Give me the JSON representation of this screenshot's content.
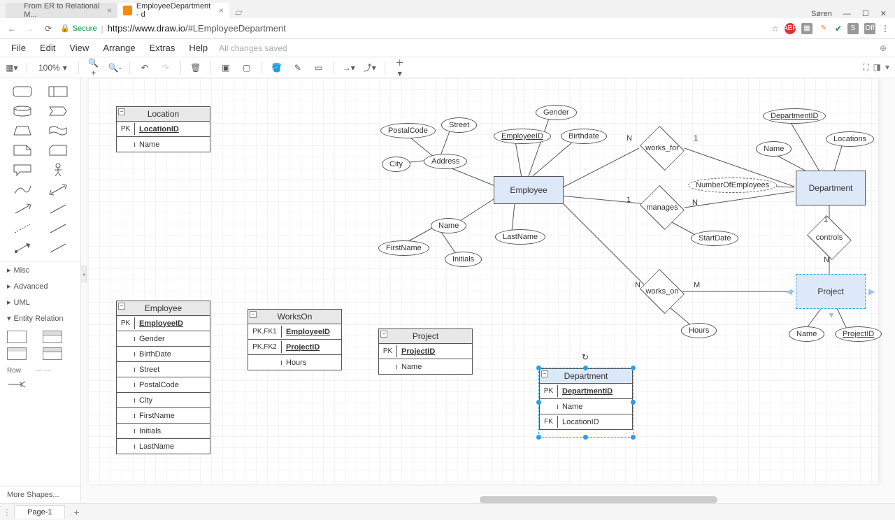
{
  "browser": {
    "tabs": [
      {
        "title": "From ER to Relational M...",
        "active": false
      },
      {
        "title": "EmployeeDepartment - d",
        "active": true
      }
    ],
    "user": "Søren",
    "url_secure": "Secure",
    "url_host": "https://www.draw.io",
    "url_path": "/#LEmployeeDepartment"
  },
  "menu": {
    "items": [
      "File",
      "Edit",
      "View",
      "Arrange",
      "Extras",
      "Help"
    ],
    "status": "All changes saved"
  },
  "toolbar": {
    "zoom": "100%"
  },
  "sidebar": {
    "cats": [
      "Misc",
      "Advanced",
      "UML",
      "Entity Relation"
    ],
    "row_label": "Row",
    "more": "More Shapes..."
  },
  "er_tables": {
    "location": {
      "title": "Location",
      "rows": [
        {
          "k": "PK",
          "v": "LocationID",
          "pk": true
        },
        {
          "k": "",
          "v": "Name"
        }
      ]
    },
    "employee": {
      "title": "Employee",
      "rows": [
        {
          "k": "PK",
          "v": "EmployeeID",
          "pk": true
        },
        {
          "k": "",
          "v": "Gender"
        },
        {
          "k": "",
          "v": "BirthDate"
        },
        {
          "k": "",
          "v": "Street"
        },
        {
          "k": "",
          "v": "PostalCode"
        },
        {
          "k": "",
          "v": "City"
        },
        {
          "k": "",
          "v": "FirstName"
        },
        {
          "k": "",
          "v": "Initials"
        },
        {
          "k": "",
          "v": "LastName"
        }
      ]
    },
    "workson": {
      "title": "WorksOn",
      "rows": [
        {
          "k": "PK,FK1",
          "v": "EmployeeID",
          "pk": true
        },
        {
          "k": "PK,FK2",
          "v": "ProjectID",
          "pk": true
        },
        {
          "k": "",
          "v": "Hours"
        }
      ]
    },
    "project": {
      "title": "Project",
      "rows": [
        {
          "k": "PK",
          "v": "ProjectID",
          "pk": true
        },
        {
          "k": "",
          "v": "Name"
        }
      ]
    },
    "department": {
      "title": "Department",
      "rows": [
        {
          "k": "PK",
          "v": "DepartmentID",
          "pk": true
        },
        {
          "k": "",
          "v": "Name"
        },
        {
          "k": "FK",
          "v": "LocationID"
        }
      ]
    }
  },
  "diagram": {
    "entities": {
      "employee": "Employee",
      "department": "Department",
      "project": "Project"
    },
    "relationships": {
      "works_for": "works_for",
      "manages": "manages",
      "controls": "controls",
      "works_on": "works_on"
    },
    "attrs": {
      "postalcode": "PostalCode",
      "street": "Street",
      "city": "City",
      "address": "Address",
      "employeeid": "EmployeeID",
      "gender": "Gender",
      "birthdate": "Birthdate",
      "name_emp": "Name",
      "firstname": "FirstName",
      "lastname": "LastName",
      "initials": "Initials",
      "name_dept": "Name",
      "departmentid": "DepartmentID",
      "locations": "Locations",
      "numemp": "NumberOfEmployees",
      "startdate": "StartDate",
      "hours": "Hours",
      "name_proj": "Name",
      "projectid": "ProjectID"
    },
    "card": {
      "wf_l": "N",
      "wf_r": "1",
      "mg_l": "1",
      "mg_r": "N",
      "ct_t": "1",
      "ct_b": "N",
      "wo_l": "N",
      "wo_r": "M"
    }
  },
  "pages": {
    "p1": "Page-1"
  }
}
